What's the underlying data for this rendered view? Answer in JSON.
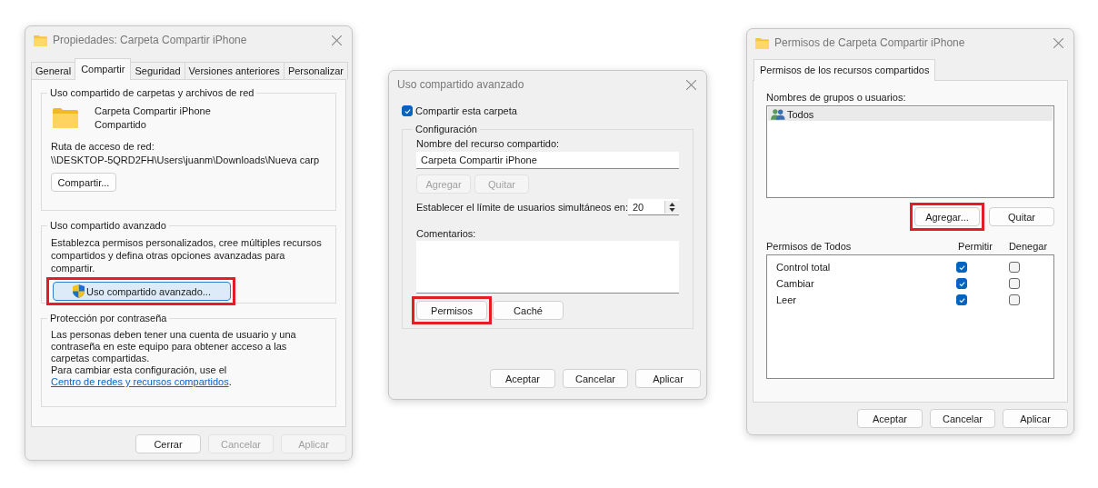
{
  "properties_dialog": {
    "title": "Propiedades: Carpeta Compartir iPhone",
    "tabs": [
      {
        "label": "General",
        "selected": false
      },
      {
        "label": "Compartir",
        "selected": true
      },
      {
        "label": "Seguridad",
        "selected": false
      },
      {
        "label": "Versiones anteriores",
        "selected": false
      },
      {
        "label": "Personalizar",
        "selected": false
      }
    ],
    "network_sharing": {
      "legend": "Uso compartido de carpetas y archivos de red",
      "folder_name": "Carpeta Compartir iPhone",
      "status": "Compartido",
      "path_label": "Ruta de acceso de red:",
      "path": "\\\\DESKTOP-5QRD2FH\\Users\\juanm\\Downloads\\Nueva carp",
      "button": {
        "label": "Compartir...",
        "highlighted": false
      }
    },
    "advanced_sharing": {
      "legend": "Uso compartido avanzado",
      "description": "Establezca permisos personalizados, cree múltiples recursos compartidos y defina otras opciones avanzadas para compartir.",
      "button": {
        "label": "Uso compartido avanzado...",
        "highlighted": true
      }
    },
    "password_protection": {
      "legend": "Protección por contraseña",
      "text": "Las personas deben tener una cuenta de usuario y una contraseña en este equipo para obtener acceso a las carpetas compartidas.",
      "hint": "Para cambiar esta configuración, use el ",
      "link": "Centro de redes y recursos compartidos",
      "hint_end": "."
    },
    "buttons": [
      {
        "label": "Cerrar",
        "disabled": false
      },
      {
        "label": "Cancelar",
        "disabled": true
      },
      {
        "label": "Aplicar",
        "disabled": true
      }
    ]
  },
  "advanced_sharing_dialog": {
    "title": "Uso compartido avanzado",
    "share_checkbox": {
      "label": "Compartir esta carpeta",
      "checked": true
    },
    "settings": {
      "legend": "Configuración",
      "name_label": "Nombre del recurso compartido:",
      "name_value": "Carpeta Compartir iPhone",
      "name_buttons": [
        {
          "label": "Agregar",
          "disabled": true
        },
        {
          "label": "Quitar",
          "disabled": true
        }
      ],
      "limit_label": "Establecer el límite de usuarios simultáneos en:",
      "limit_value": "20",
      "comments_label": "Comentarios:",
      "buttons": [
        {
          "label": "Permisos",
          "highlighted": true
        },
        {
          "label": "Caché",
          "highlighted": false
        }
      ]
    },
    "buttons": [
      {
        "label": "Aceptar",
        "disabled": false
      },
      {
        "label": "Cancelar",
        "disabled": false
      },
      {
        "label": "Aplicar",
        "disabled": false
      }
    ]
  },
  "permissions_dialog": {
    "title": "Permisos de Carpeta Compartir iPhone",
    "tabs": [
      {
        "label": "Permisos de los recursos compartidos",
        "selected": true
      }
    ],
    "users_label": "Nombres de grupos o usuarios:",
    "users": [
      {
        "name": "Todos",
        "selected": true
      }
    ],
    "user_buttons": [
      {
        "label": "Agregar...",
        "highlighted": true
      },
      {
        "label": "Quitar",
        "highlighted": false
      }
    ],
    "permissions_label": "Permisos de Todos",
    "allow_header": "Permitir",
    "deny_header": "Denegar",
    "permissions": [
      {
        "name": "Control total",
        "allow": true,
        "deny": false
      },
      {
        "name": "Cambiar",
        "allow": true,
        "deny": false
      },
      {
        "name": "Leer",
        "allow": true,
        "deny": false
      }
    ],
    "buttons": [
      {
        "label": "Aceptar",
        "disabled": false
      },
      {
        "label": "Cancelar",
        "disabled": false
      },
      {
        "label": "Aplicar",
        "disabled": false
      }
    ]
  }
}
